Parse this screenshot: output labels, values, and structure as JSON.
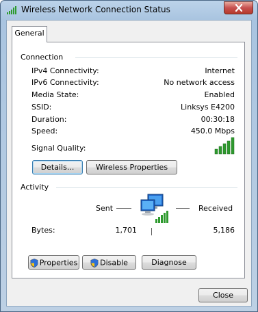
{
  "window": {
    "title": "Wireless Network Connection Status"
  },
  "tabs": [
    {
      "label": "General"
    }
  ],
  "connection": {
    "header": "Connection",
    "rows": [
      {
        "label": "IPv4 Connectivity:",
        "value": "Internet"
      },
      {
        "label": "IPv6 Connectivity:",
        "value": "No network access"
      },
      {
        "label": "Media State:",
        "value": "Enabled"
      },
      {
        "label": "SSID:",
        "value": "Linksys E4200"
      },
      {
        "label": "Duration:",
        "value": "00:30:18"
      },
      {
        "label": "Speed:",
        "value": "450.0 Mbps"
      }
    ],
    "signal_label": "Signal Quality:",
    "signal_bars": 5,
    "details_button": "Details...",
    "wireless_properties_button": "Wireless Properties"
  },
  "activity": {
    "header": "Activity",
    "sent_label": "Sent",
    "received_label": "Received",
    "bytes_label": "Bytes:",
    "bytes_sent": "1,701",
    "bytes_received": "5,186"
  },
  "actions": {
    "properties_button": "Properties",
    "disable_button": "Disable",
    "diagnose_button": "Diagnose"
  },
  "footer": {
    "close_button": "Close"
  },
  "icons": {
    "title": "wireless-signal-icon",
    "close": "close-icon",
    "shield": "uac-shield-icon",
    "activity": "network-computers-icon"
  },
  "colors": {
    "signal_green": "#2e9a2e",
    "titlebar": "#bcd3ea"
  }
}
